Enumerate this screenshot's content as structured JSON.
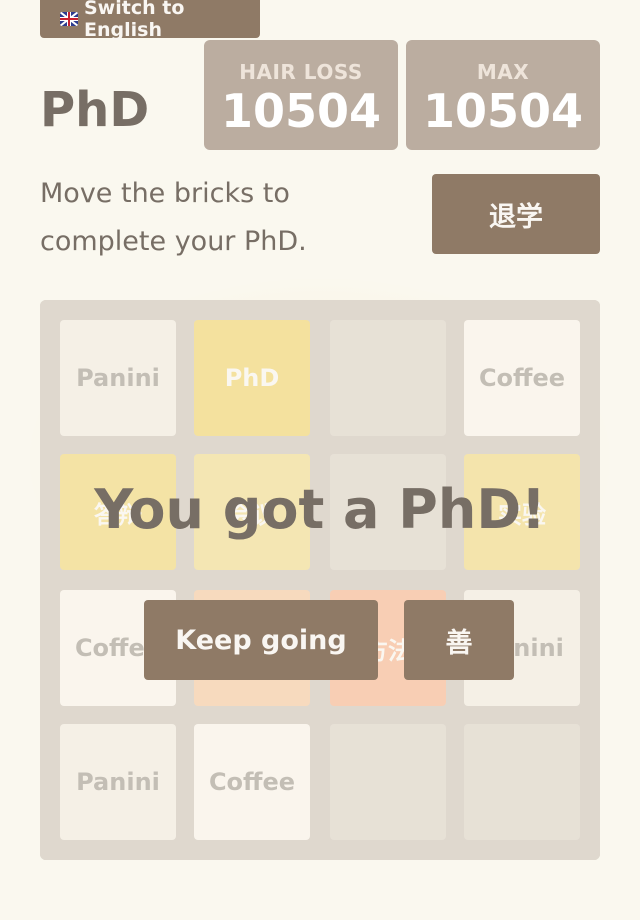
{
  "header": {
    "switch_language_label": "Switch to English",
    "title": "PhD",
    "intro": "Move the bricks to complete your PhD.",
    "quit_label": "退学"
  },
  "scores": {
    "hair_loss_label": "HAIR LOSS",
    "hair_loss_value": "10504",
    "max_label": "MAX",
    "max_value": "10504"
  },
  "board": {
    "rows": [
      [
        {
          "label": "Panini",
          "bg": "#eee4da"
        },
        {
          "label": "PhD",
          "bg": "#edc22e",
          "fg": "#f9f6f2"
        },
        {
          "label": "",
          "bg": ""
        },
        {
          "label": "Coffee",
          "bg": "#f9f0ea"
        }
      ],
      [
        {
          "label": "答辩",
          "bg": "#edc53f",
          "fg": "#f9f6f2"
        },
        {
          "label": "会议",
          "bg": "#edcc61",
          "fg": "#f9f6f2"
        },
        {
          "label": "",
          "bg": ""
        },
        {
          "label": "实验",
          "bg": "#edc850",
          "fg": "#f9f6f2"
        }
      ],
      [
        {
          "label": "Coffee",
          "bg": "#f9f0ea"
        },
        {
          "label": "",
          "bg": "#f2b179",
          "fg": "#f9f6f2"
        },
        {
          "label": "方法",
          "bg": "#f59563",
          "fg": "#f9f6f2"
        },
        {
          "label": "Panini",
          "bg": "#eee4da"
        }
      ],
      [
        {
          "label": "Panini",
          "bg": "#eee4da"
        },
        {
          "label": "Coffee",
          "bg": "#f9f0ea"
        },
        {
          "label": "",
          "bg": ""
        },
        {
          "label": "",
          "bg": ""
        }
      ]
    ]
  },
  "overlay": {
    "message": "You got a PhD!",
    "keep_going_label": "Keep going",
    "good_label": "善"
  },
  "colors": {
    "background": "#faf8ef",
    "board": "#bbada0",
    "button": "#8f7a66",
    "text": "#776e65"
  }
}
